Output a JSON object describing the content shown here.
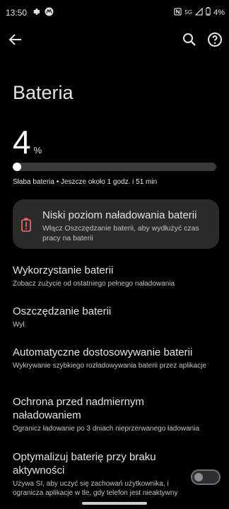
{
  "status_bar": {
    "time": "13:50",
    "left_icons": [
      "settings-gear-icon",
      "motorola-icon"
    ],
    "right_icons": [
      "nfc-icon",
      "5g-signal-icon",
      "battery-icon"
    ],
    "network_label": "5G",
    "battery_percent": "4%"
  },
  "app_bar": {
    "icons": [
      "back-arrow-icon",
      "search-icon",
      "help-icon"
    ]
  },
  "page": {
    "title": "Bateria"
  },
  "battery": {
    "level": "4",
    "unit": "%",
    "level_fraction": 0.04,
    "estimate": "Słaba bateria • Jeszcze około 1 godz. i 51 min"
  },
  "alert_card": {
    "title": "Niski poziom naładowania baterii",
    "subtitle": "Włącz Oszczędzanie baterii, aby wydłużyć czas pracy na baterii",
    "accent": "#ff6b6b"
  },
  "items": [
    {
      "title": "Wykorzystanie baterii",
      "subtitle": "Zobacz zużycie od ostatniego pełnego naładowania"
    },
    {
      "title": "Oszczędzanie baterii",
      "subtitle": "Wył."
    },
    {
      "title": "Automatyczne dostosowywanie baterii",
      "subtitle": "Wykrywanie szybkiego rozładowywania baterii przez aplikacje"
    },
    {
      "title": "Ochrona przed nadmiernym naładowaniem",
      "subtitle": "Ogranicz ładowanie po 3 dniach nieprzerwanego ładowania"
    },
    {
      "title": "Optymalizuj baterię przy braku aktywności",
      "subtitle": "Używa SI, aby uczyć się zachowań użytkownika, i ogranicza aplikacje w tle, gdy telefon jest nieaktywny",
      "toggle_on": false
    }
  ]
}
